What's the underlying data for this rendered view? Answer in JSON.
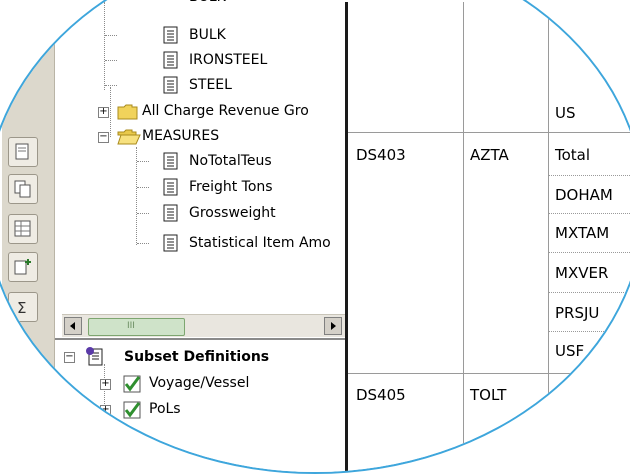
{
  "tree": {
    "items": [
      {
        "label": "BULK"
      },
      {
        "label": "IRONSTEEL"
      },
      {
        "label": "STEEL"
      },
      {
        "label": "All Charge Revenue Gro"
      },
      {
        "label": "MEASURES"
      },
      {
        "label": "NoTotalTeus"
      },
      {
        "label": "Freight Tons"
      },
      {
        "label": "Grossweight"
      },
      {
        "label": "Statistical Item Amo"
      }
    ],
    "top_partial": "BULK",
    "expand_plus": "+",
    "expand_minus": "−"
  },
  "scrollbar": {
    "thumb_grip": "III"
  },
  "subset": {
    "title": "Subset Definitions",
    "items": [
      {
        "label": "Voyage/Vessel"
      },
      {
        "label": "PoLs"
      }
    ]
  },
  "table": {
    "rows": [
      {
        "c1": "",
        "c2": "",
        "c3": "US"
      },
      {
        "c1": "DS403",
        "c2": "AZTA",
        "c3": "Total"
      },
      {
        "c1": "",
        "c2": "",
        "c3": "DOHAM"
      },
      {
        "c1": "",
        "c2": "",
        "c3": "MXTAM"
      },
      {
        "c1": "",
        "c2": "",
        "c3": "MXVER"
      },
      {
        "c1": "",
        "c2": "",
        "c3": "PRSJU"
      },
      {
        "c1": "",
        "c2": "",
        "c3": "USF"
      },
      {
        "c1": "DS405",
        "c2": "TOLT",
        "c3": ""
      }
    ]
  },
  "colors": {
    "accent": "#3ea6dc",
    "folder": "#e8c84a",
    "check": "#3c9a3c"
  }
}
